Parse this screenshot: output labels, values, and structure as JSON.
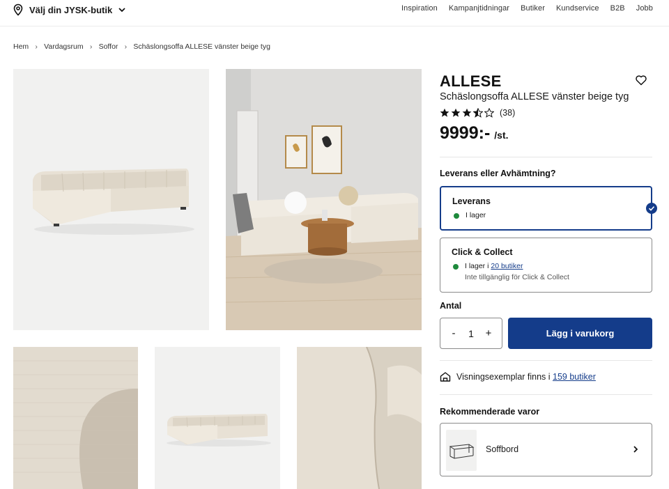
{
  "header": {
    "store_label": "Välj din JYSK-butik",
    "nav": [
      "Inspiration",
      "Kampanjtidningar",
      "Butiker",
      "Kundservice",
      "B2B",
      "Jobb"
    ]
  },
  "breadcrumb": [
    "Hem",
    "Vardagsrum",
    "Soffor",
    "Schäslongsoffa ALLESE vänster beige tyg"
  ],
  "product": {
    "brand": "ALLESE",
    "subtitle": "Schäslongsoffa ALLESE vänster beige tyg",
    "rating": 3.5,
    "rating_count": "(38)",
    "price": "9999:-",
    "unit": "/st."
  },
  "delivery": {
    "question": "Leverans eller Avhämtning?",
    "options": [
      {
        "title": "Leverans",
        "status": "I lager",
        "selected": true
      },
      {
        "title": "Click & Collect",
        "status_prefix": "I lager i ",
        "status_link": "20 butiker",
        "note": "Inte tillgänglig för Click & Collect",
        "selected": false
      }
    ]
  },
  "quantity": {
    "label": "Antal",
    "minus": "-",
    "value": "1",
    "plus": "+"
  },
  "cart_button": "Lägg i varukorg",
  "showroom": {
    "text": "Visningsexemplar finns i ",
    "link": "159 butiker"
  },
  "recommended": {
    "title": "Rekommenderade varor",
    "items": [
      {
        "name": "Soffbord"
      }
    ]
  },
  "colors": {
    "accent": "#143c8a",
    "in_stock": "#1e8a3c",
    "fabric": "#ebe5da"
  }
}
